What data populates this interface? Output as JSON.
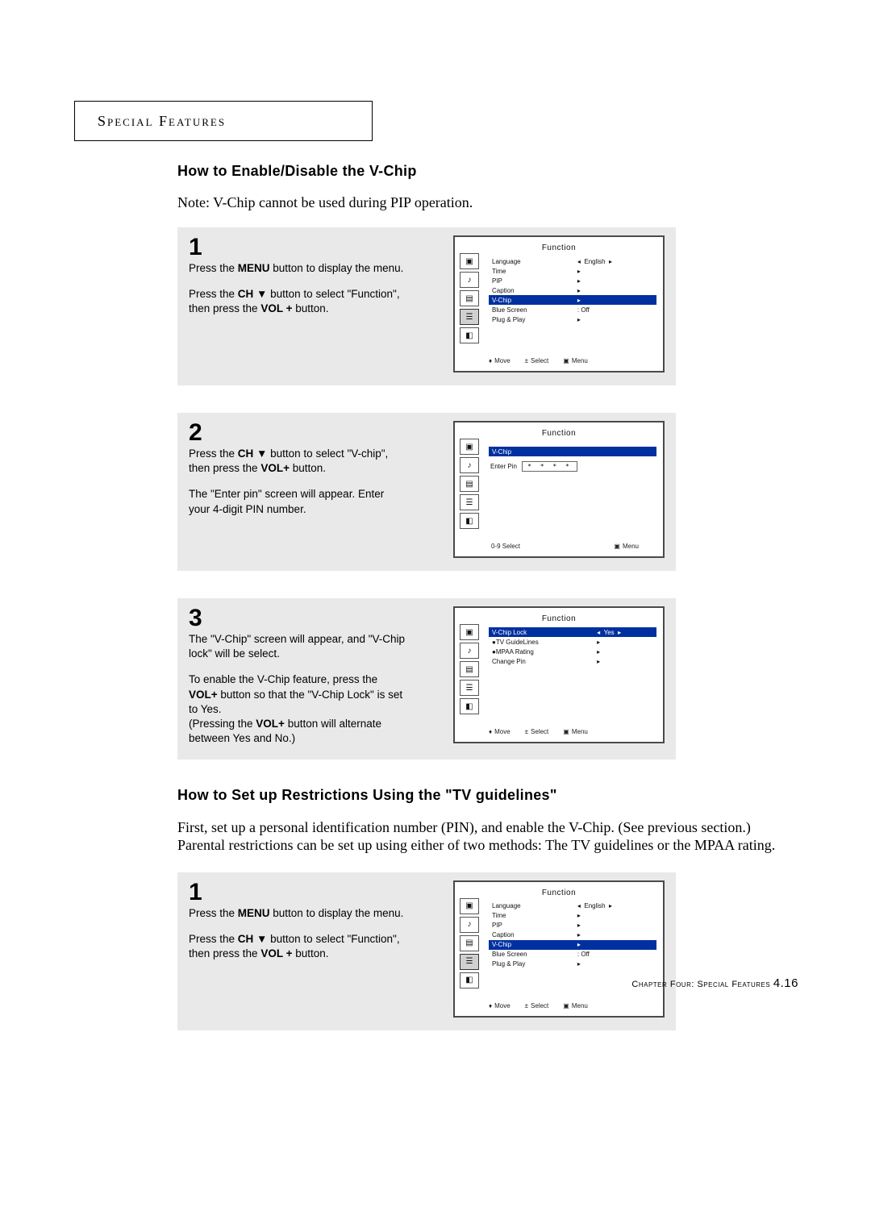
{
  "section_header": "Special Features",
  "heading_a": "How to Enable/Disable the V-Chip",
  "note_a": "Note: V-Chip cannot be used during PIP operation.",
  "step1": {
    "num": "1",
    "p1_html": "Press the <b>MENU</b> button to display the menu.",
    "p2_html": "Press the <b>CH</b> ▼ button to select \"Function\", then press the <b>VOL +</b> button."
  },
  "step2": {
    "num": "2",
    "p1_html": "Press the <b>CH</b> ▼ button to select \"V-chip\", then press the <b>VOL+</b> button.",
    "p2_html": "The \"Enter pin\" screen will appear. Enter your 4-digit PIN number."
  },
  "step3": {
    "num": "3",
    "p1_html": "The \"V-Chip\" screen will appear, and \"V-Chip lock\" will be select.",
    "p2_html": "To enable the V-Chip feature, press the <b>VOL+</b> button so that the \"V-Chip Lock\" is set to Yes.<br>(Pressing the <b>VOL+</b> button will alternate between Yes and No.)"
  },
  "heading_b": "How to Set up Restrictions Using the \"TV guidelines\"",
  "para_b": "First, set up a personal identification number (PIN), and enable the V-Chip. (See previous section.)  Parental restrictions can be set up using either of two methods: The TV guidelines or the MPAA rating.",
  "step4": {
    "num": "1",
    "p1_html": "Press the <b>MENU</b> button to display the menu.",
    "p2_html": "Press the <b>CH</b> ▼ button to select \"Function\", then press the <b>VOL +</b> button."
  },
  "osd": {
    "title": "Function",
    "footer_move": "Move",
    "footer_select": "Select",
    "footer_menu": "Menu",
    "menu1": {
      "rows": [
        {
          "label": "Language",
          "value": "English",
          "arrows": "lr"
        },
        {
          "label": "Time",
          "value": "",
          "arrows": "r"
        },
        {
          "label": "PIP",
          "value": "",
          "arrows": "r"
        },
        {
          "label": "Caption",
          "value": "",
          "arrows": "r"
        },
        {
          "label": "V-Chip",
          "value": "",
          "arrows": "r",
          "selected": true
        },
        {
          "label": "Blue Screen",
          "value": ": Off",
          "arrows": ""
        },
        {
          "label": "Plug & Play",
          "value": "",
          "arrows": "r"
        }
      ]
    },
    "menu2": {
      "header": "V-Chip",
      "enter_pin_label": "Enter Pin",
      "enter_pin_value": "* * * *",
      "footer_09": "0-9 Select"
    },
    "menu3": {
      "rows": [
        {
          "label": "V-Chip Lock",
          "value": "Yes",
          "arrows": "lr",
          "selected": true
        },
        {
          "label": "●TV GuideLines",
          "value": "",
          "arrows": "r"
        },
        {
          "label": "●MPAA Rating",
          "value": "",
          "arrows": "r"
        },
        {
          "label": "Change Pin",
          "value": "",
          "arrows": "r"
        }
      ]
    }
  },
  "footer_text": "Chapter Four: Special Features",
  "footer_page": "4.16"
}
